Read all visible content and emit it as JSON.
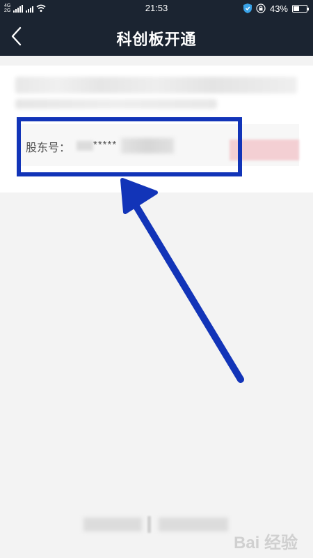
{
  "status_bar": {
    "network_top": "4G",
    "network_bottom": "2G",
    "time": "21:53",
    "battery": "43%",
    "battery_level": 0.43,
    "icons": [
      "signal-icon",
      "wifi-icon",
      "shield-icon",
      "lock-rotation-icon",
      "battery-icon"
    ]
  },
  "nav": {
    "title": "科创板开通",
    "back_icon": "chevron-left-icon"
  },
  "shareholder": {
    "label": "股东号：",
    "masked_value": "*****"
  },
  "colors": {
    "nav_bg": "#1b2431",
    "page_bg": "#f3f3f3",
    "highlight": "#1234b8",
    "button_pink": "#f3cfd3"
  },
  "watermark": "Bai 经验"
}
